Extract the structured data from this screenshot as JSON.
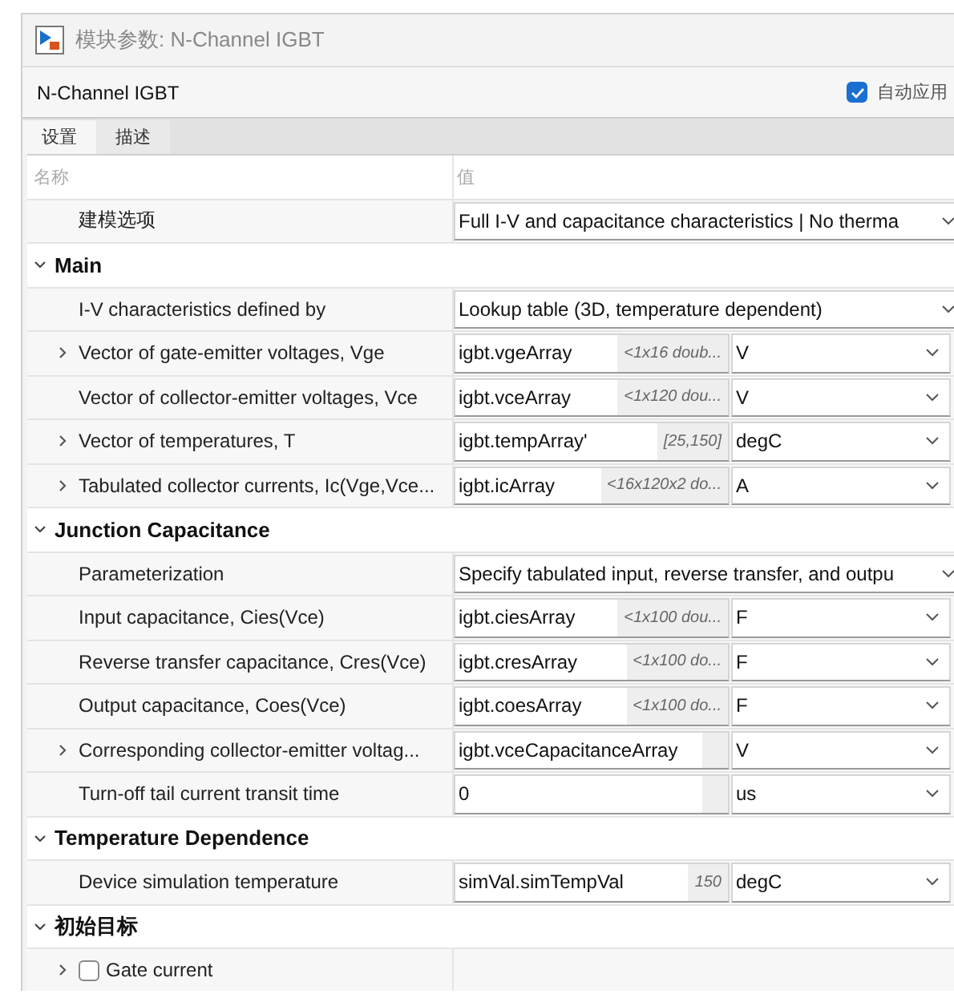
{
  "window": {
    "title": "模块参数: N-Channel IGBT"
  },
  "header": {
    "block_name": "N-Channel IGBT",
    "auto_apply": {
      "label": "自动应用",
      "checked": true
    }
  },
  "tabs": [
    {
      "label": "设置",
      "selected": true
    },
    {
      "label": "描述",
      "selected": false
    }
  ],
  "grid": {
    "columns": [
      "名称",
      "值"
    ],
    "top_rows": [
      {
        "kind": "dropdown",
        "name": "建模选项",
        "value": "Full I-V and capacitance characteristics | No therma",
        "expandable": false
      }
    ],
    "sections": [
      {
        "title": "Main",
        "expanded": true,
        "rows": [
          {
            "kind": "dropdown",
            "name": "I-V characteristics defined by",
            "value": "Lookup table (3D, temperature dependent)",
            "expandable": false
          },
          {
            "kind": "expr",
            "name": "Vector of gate-emitter voltages, Vge",
            "expression": "igbt.vgeArray",
            "preview": "<1x16 doub...",
            "unit": "V",
            "expandable": true
          },
          {
            "kind": "expr",
            "name": "Vector of collector-emitter voltages, Vce",
            "expression": "igbt.vceArray",
            "preview": "<1x120 dou...",
            "unit": "V",
            "expandable": false
          },
          {
            "kind": "expr",
            "name": "Vector of temperatures, T",
            "expression": "igbt.tempArray'",
            "preview": "[25,150]",
            "unit": "degC",
            "expandable": true
          },
          {
            "kind": "expr",
            "name": "Tabulated collector currents, Ic(Vge,Vce...",
            "expression": "igbt.icArray",
            "preview": "<16x120x2 do...",
            "unit": "A",
            "expandable": true
          }
        ]
      },
      {
        "title": "Junction Capacitance",
        "expanded": true,
        "rows": [
          {
            "kind": "dropdown",
            "name": "Parameterization",
            "value": "Specify tabulated input, reverse transfer, and outpu",
            "expandable": false
          },
          {
            "kind": "expr",
            "name": "Input capacitance, Cies(Vce)",
            "expression": "igbt.ciesArray",
            "preview": "<1x100 dou...",
            "unit": "F",
            "expandable": false
          },
          {
            "kind": "expr",
            "name": "Reverse transfer capacitance, Cres(Vce)",
            "expression": "igbt.cresArray",
            "preview": "<1x100 do...",
            "unit": "F",
            "expandable": false
          },
          {
            "kind": "expr",
            "name": "Output capacitance, Coes(Vce)",
            "expression": "igbt.coesArray",
            "preview": "<1x100 do...",
            "unit": "F",
            "expandable": false
          },
          {
            "kind": "expr",
            "name": "Corresponding collector-emitter voltag...",
            "expression": "igbt.vceCapacitanceArray",
            "unit": "V",
            "expandable": true
          },
          {
            "kind": "expr",
            "name": "Turn-off tail current transit time",
            "expression": "0",
            "unit": "us",
            "expandable": false
          }
        ]
      },
      {
        "title": "Temperature Dependence",
        "expanded": true,
        "rows": [
          {
            "kind": "expr",
            "name": "Device simulation temperature",
            "expression": "simVal.simTempVal",
            "preview": "150",
            "unit": "degC",
            "expandable": false
          }
        ]
      },
      {
        "title": "初始目标",
        "expanded": true,
        "rows": [
          {
            "kind": "checkbox",
            "name": "Gate current",
            "checked": false,
            "expandable": true
          }
        ]
      }
    ]
  }
}
